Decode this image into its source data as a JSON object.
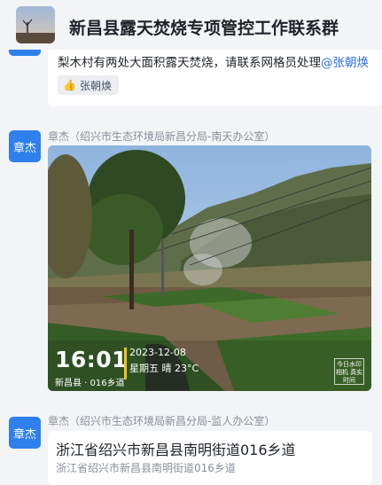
{
  "header": {
    "group_title": "新昌县露天焚烧专项管控工作联系群"
  },
  "messages": [
    {
      "text": "梨木村有两处大面积露天焚烧，请联系网格员处理",
      "mention": "@张朝焕",
      "reaction": {
        "icon": "thumbs-up-icon",
        "name": "张朝焕"
      }
    },
    {
      "avatar_text": "章杰",
      "sender_name": "章杰",
      "sender_org": "（绍兴市生态环境局新昌分局-南天办公室）",
      "photo": {
        "time": "16:01",
        "date": "2023-12-08",
        "weather": "星期五 晴 23°C",
        "location": "新昌县 · 016乡道",
        "stamp": "今日水印 相机 真实时间"
      }
    },
    {
      "avatar_text": "章杰",
      "sender_name": "章杰",
      "sender_org": "（绍兴市生态环境局新昌分局-监人办公室）",
      "address_main": "浙江省绍兴市新昌县南明街道016乡道",
      "address_sub": "浙江省绍兴市新昌县南明街道016乡道"
    }
  ],
  "colors": {
    "accent": "#2f80ed",
    "background": "#f3f4f6",
    "watermark_bar": "#f3c41c"
  }
}
